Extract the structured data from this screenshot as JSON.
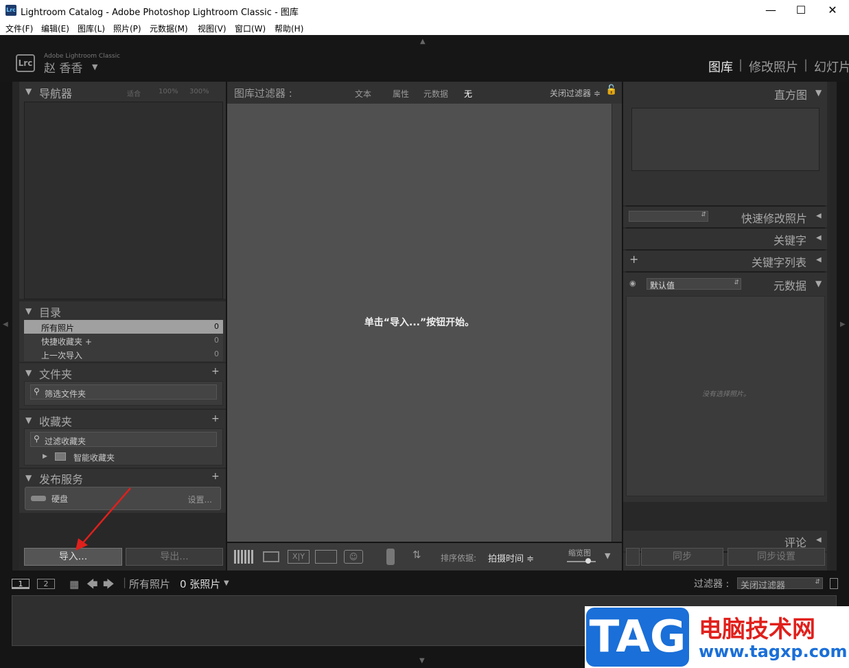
{
  "window": {
    "app_icon": "Lrc",
    "title": "Lightroom Catalog - Adobe Photoshop Lightroom Classic - 图库"
  },
  "menu": [
    "文件(F)",
    "编辑(E)",
    "图库(L)",
    "照片(P)",
    "元数据(M)",
    "视图(V)",
    "窗口(W)",
    "帮助(H)"
  ],
  "identity": {
    "logo": "Lrc",
    "product": "Adobe Lightroom Classic",
    "user": "赵 香香"
  },
  "modules": [
    "图库",
    "修改照片",
    "幻灯片"
  ],
  "navigator": {
    "title": "导航器",
    "zoom": [
      "适合",
      "100%",
      "300%"
    ]
  },
  "catalog": {
    "title": "目录",
    "items": [
      {
        "label": "所有照片",
        "count": "0"
      },
      {
        "label": "快捷收藏夹 +",
        "count": "0"
      },
      {
        "label": "上一次导入",
        "count": "0"
      }
    ]
  },
  "folders": {
    "title": "文件夹",
    "filter_placeholder": "筛选文件夹"
  },
  "collections": {
    "title": "收藏夹",
    "filter_placeholder": "过滤收藏夹",
    "smart": "智能收藏夹"
  },
  "publish": {
    "title": "发布服务",
    "service": "硬盘",
    "settings": "设置..."
  },
  "left_buttons": {
    "import": "导入...",
    "export": "导出..."
  },
  "filter_bar": {
    "title": "图库过滤器 :",
    "options": [
      "文本",
      "属性",
      "元数据",
      "无"
    ],
    "close": "关闭过滤器 ≑"
  },
  "center": {
    "message": "单击“导入...”按钮开始。"
  },
  "toolbar": {
    "sort_label": "排序依据:",
    "sort_value": "拍摄时间 ≑",
    "thumb_label": "缩览图"
  },
  "right": {
    "histogram": "直方图",
    "quick_develop": "快速修改照片",
    "keywording": "关键字",
    "keyword_list": "关键字列表",
    "metadata": "元数据",
    "metadata_preset": "默认值",
    "no_photo": "没有选择照片。",
    "comments": "评论",
    "sync": "同步",
    "sync_settings": "同步设置"
  },
  "filmstrip": {
    "pages": [
      "1",
      "2"
    ],
    "source": "所有照片",
    "count": "0 张照片",
    "filter_label": "过滤器 :",
    "filter_value": "关闭过滤器"
  },
  "watermark": {
    "tag": "TAG",
    "site_name": "电脑技术网",
    "url": "www.tagxp.com"
  },
  "colors": {
    "panel": "#323232",
    "background": "#151515",
    "center": "#505050",
    "accent_red": "#e0201c",
    "tag_blue": "#1a6fd8"
  }
}
